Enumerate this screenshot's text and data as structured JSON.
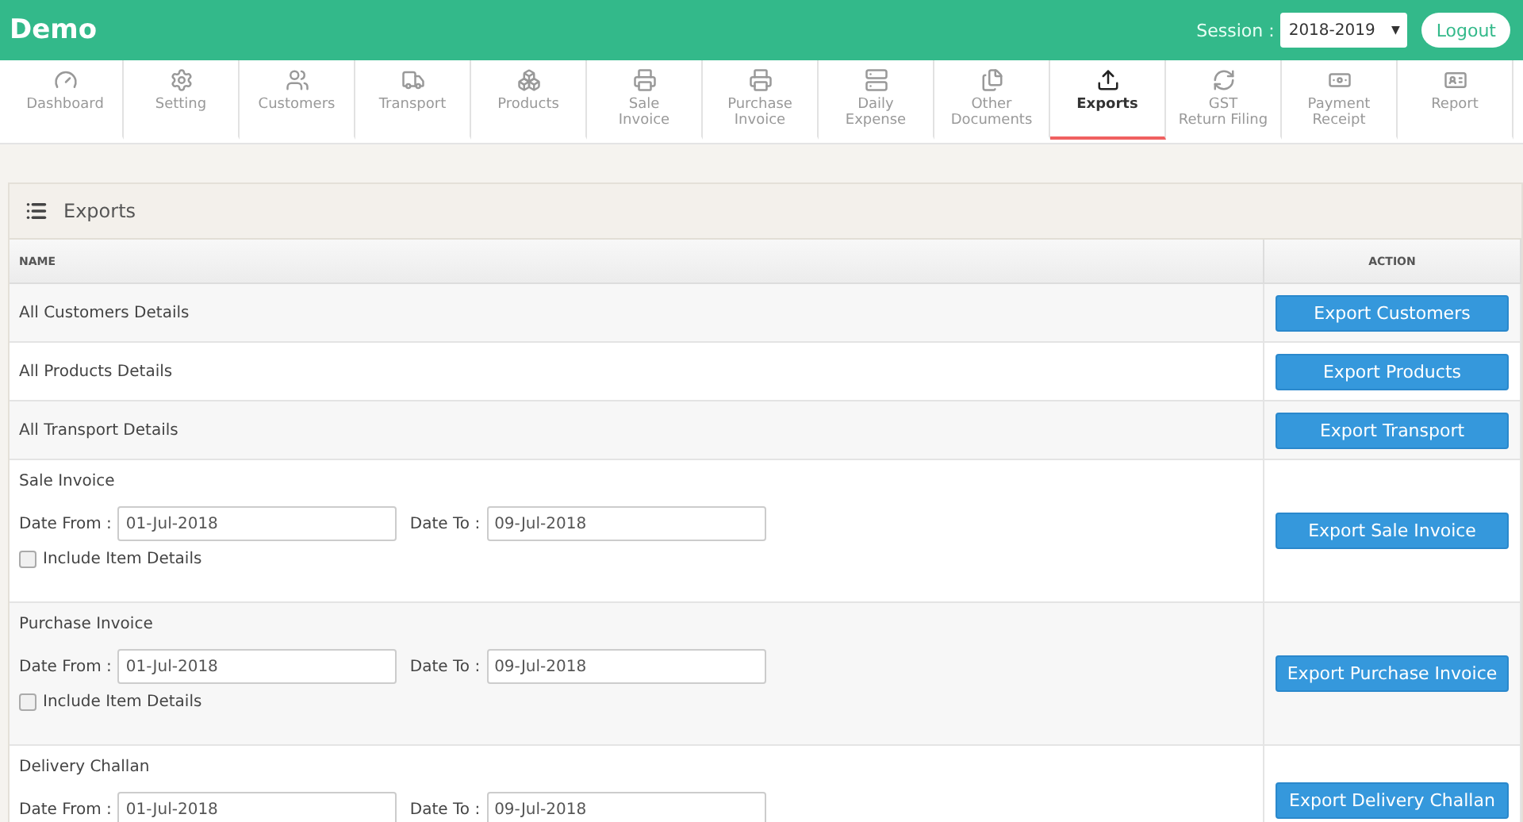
{
  "app": {
    "title": "Demo",
    "session_label": "Session :",
    "session_value": "2018-2019",
    "session_caret": "▼",
    "logout": "Logout"
  },
  "tabs": [
    {
      "label": "Dashboard",
      "selected": false
    },
    {
      "label": "Setting",
      "selected": false
    },
    {
      "label": "Customers",
      "selected": false
    },
    {
      "label": "Transport",
      "selected": false
    },
    {
      "label": "Products",
      "selected": false
    },
    {
      "label": "Sale\nInvoice",
      "selected": false
    },
    {
      "label": "Purchase\nInvoice",
      "selected": false
    },
    {
      "label": "Daily\nExpense",
      "selected": false
    },
    {
      "label": "Other\nDocuments",
      "selected": false
    },
    {
      "label": "Exports",
      "selected": true
    },
    {
      "label": "GST\nReturn Filing",
      "selected": false
    },
    {
      "label": "Payment\nReceipt",
      "selected": false
    },
    {
      "label": "Report",
      "selected": false
    }
  ],
  "panel": {
    "title": "Exports",
    "columns": [
      "NAME",
      "ACTION"
    ],
    "rows": [
      {
        "kind": "simple",
        "name": "All Customers Details",
        "action": "Export Customers"
      },
      {
        "kind": "simple",
        "name": "All Products Details",
        "action": "Export Products"
      },
      {
        "kind": "simple",
        "name": "All Transport Details",
        "action": "Export Transport"
      },
      {
        "kind": "dates",
        "name": "Sale Invoice",
        "from_label": "Date From :",
        "from": "01-Jul-2018",
        "to_label": "Date To :",
        "to": "09-Jul-2018",
        "checkbox_label": "Include Item Details",
        "checked": false,
        "action": "Export Sale Invoice"
      },
      {
        "kind": "dates",
        "name": "Purchase Invoice",
        "from_label": "Date From :",
        "from": "01-Jul-2018",
        "to_label": "Date To :",
        "to": "09-Jul-2018",
        "checkbox_label": "Include Item Details",
        "checked": false,
        "action": "Export Purchase Invoice"
      },
      {
        "kind": "dates",
        "name": "Delivery Challan",
        "from_label": "Date From :",
        "from": "01-Jul-2018",
        "to_label": "Date To :",
        "to": "09-Jul-2018",
        "action": "Export Delivery Challan"
      }
    ]
  }
}
